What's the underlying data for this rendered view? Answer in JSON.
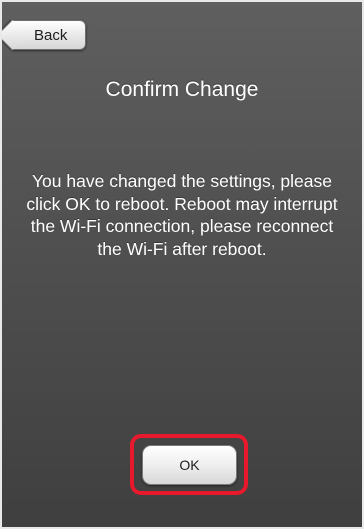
{
  "nav": {
    "back_label": "Back"
  },
  "dialog": {
    "title": "Confirm Change",
    "message": "You have changed the settings, please click OK to reboot. Reboot may interrupt the Wi-Fi connection, please reconnect the Wi-Fi after reboot.",
    "ok_label": "OK"
  },
  "colors": {
    "background": "#535353",
    "text": "#ffffff",
    "highlight": "#e8192c",
    "button": "#efefef"
  },
  "icons": {
    "back": "back-arrow-icon"
  }
}
